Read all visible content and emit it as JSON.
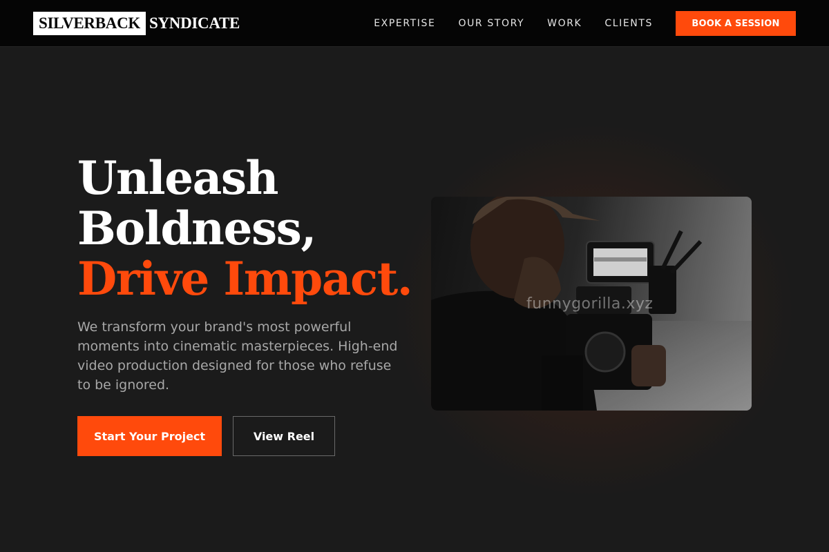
{
  "brand": {
    "name_part1": "SILVERBACK",
    "name_part2": "SYNDICATE"
  },
  "nav": {
    "links": [
      {
        "label": "EXPERTISE"
      },
      {
        "label": "OUR STORY"
      },
      {
        "label": "WORK"
      },
      {
        "label": "CLIENTS"
      }
    ],
    "cta_label": "BOOK A SESSION"
  },
  "hero": {
    "title_line1": "Unleash",
    "title_line2": "Boldness,",
    "title_accent": "Drive Impact.",
    "description": "We transform your brand's most powerful moments into cinematic masterpieces. High-end video production designed for those who refuse to be ignored.",
    "primary_button": "Start Your Project",
    "secondary_button": "View Reel",
    "image_watermark": "funnygorilla.xyz"
  },
  "colors": {
    "accent": "#ff4a0c",
    "background": "#1b1b1b",
    "navbar": "#050505"
  },
  "icons": {
    "hero_image": "videographer-with-camera-rig-photo"
  }
}
